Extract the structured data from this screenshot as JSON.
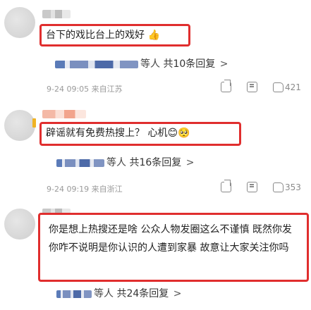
{
  "comments": [
    {
      "text": "台下的戏比台上的戏好 👍",
      "reply_suffix": "等人",
      "reply_count": "共10条回复",
      "reply_arrow": ">",
      "time": "9-24 09:05",
      "location": "来自江苏",
      "likes": "421"
    },
    {
      "text": "辟谣就有免费热搜上？ 心机😊🥺",
      "reply_suffix": "等人",
      "reply_count": "共16条回复",
      "reply_arrow": ">",
      "time": "9-24 09:19",
      "location": "来自浙江",
      "likes": "353"
    },
    {
      "text": "你是想上热搜还是啥 公众人物发圈这么不谨慎 既然你发你咋不说明是你认识的人遭到家暴 故意让大家关注你吗",
      "reply_suffix": "等人",
      "reply_count": "共24条回复",
      "reply_arrow": ">"
    }
  ],
  "icons": {
    "share": "share-icon",
    "comment": "comment-icon",
    "like": "thumb-up-icon"
  },
  "colors": {
    "highlight_border": "#e02e2e",
    "meta_text": "#9a9a9a",
    "side_mark": "#f0b323"
  }
}
